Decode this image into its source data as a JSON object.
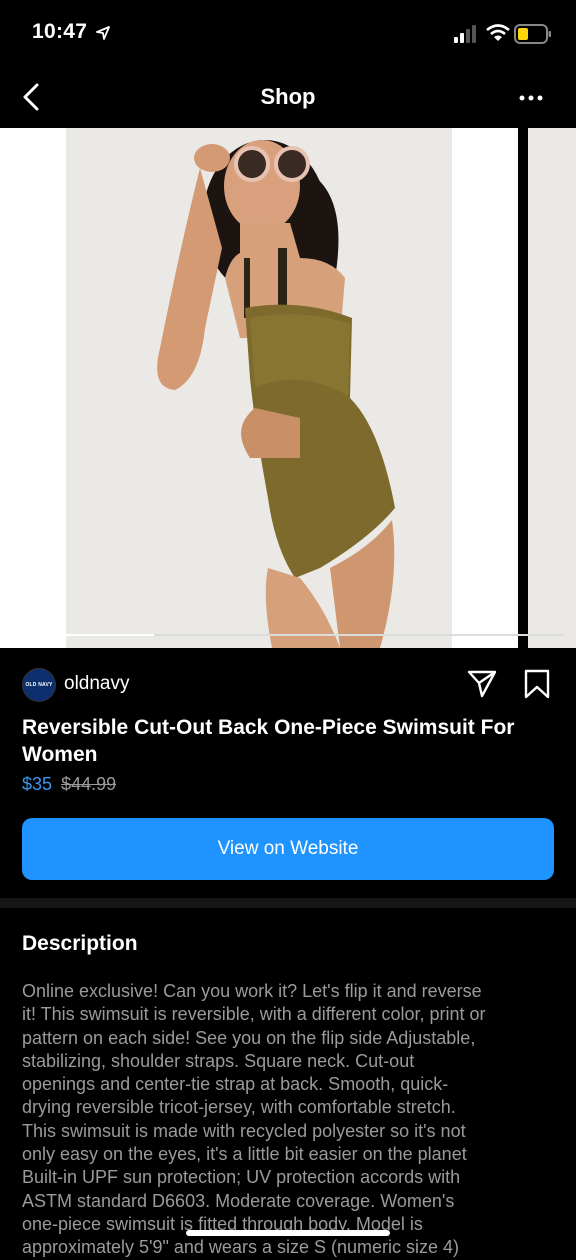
{
  "status_bar": {
    "time": "10:47"
  },
  "header": {
    "title": "Shop"
  },
  "seller": {
    "avatar_text": "OLD NAVY",
    "handle": "oldnavy"
  },
  "product": {
    "title": "Reversible Cut-Out Back One-Piece Swimsuit For Women",
    "price": "$35",
    "original_price": "$44.99"
  },
  "cta": {
    "label": "View on Website"
  },
  "description": {
    "heading": "Description",
    "text": "Online exclusive! Can you work it? Let's flip it and reverse\nit! This swimsuit is reversible, with a different color, print or\npattern on each side! See you on the flip side Adjustable,\nstabilizing, shoulder straps.  Square neck.  Cut-out\nopenings and center-tie strap at back.  Smooth, quick-\ndrying reversible tricot-jersey, with comfortable stretch.\nThis swimsuit is made with recycled polyester so it's not\nonly easy on the eyes, it's a little bit easier on the planet\nBuilt-in UPF sun protection; UV protection accords with\nASTM standard D6603.  Moderate coverage.  Women's\none-piece swimsuit is fitted through body.  Model is\napproximately 5'9\" and wears a size S (numeric size 4)"
  },
  "icons": {
    "back": "chevron-left-icon",
    "more": "more-icon",
    "share": "paper-plane-icon",
    "save": "bookmark-icon"
  }
}
